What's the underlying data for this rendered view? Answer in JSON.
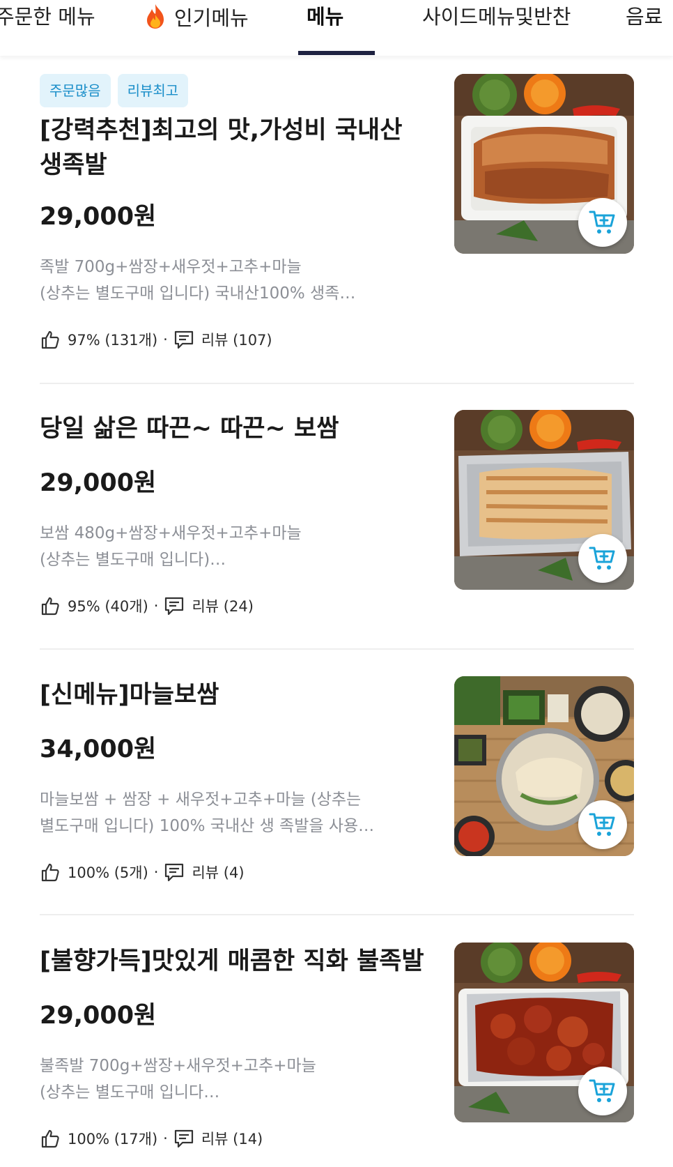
{
  "tabs": [
    {
      "label": "주문한 메뉴",
      "active": false
    },
    {
      "label": "인기메뉴",
      "active": false,
      "icon": "fire-icon"
    },
    {
      "label": "메뉴",
      "active": true
    },
    {
      "label": "사이드메뉴및반찬",
      "active": false
    },
    {
      "label": "음료",
      "active": false
    }
  ],
  "items": [
    {
      "badges": [
        "주문많음",
        "리뷰최고"
      ],
      "name": "[강력추천]최고의 맛,가성비 국내산 생족발",
      "price": "29,000원",
      "desc_line1": "족발 700g+쌈장+새우젓+고추+마늘",
      "desc_line2": " (상추는 별도구매 입니다) 국내산100% 생족…",
      "rating": "97% (131개)",
      "reviews": "리뷰 (107)",
      "image": "jokbal-photo"
    },
    {
      "badges": [],
      "name": "당일 삶은 따끈~ 따끈~ 보쌈",
      "price": "29,000원",
      "desc_line1": "보쌈 480g+쌈장+새우젓+고추+마늘",
      "desc_line2": " (상추는 별도구매 입니다)…",
      "rating": "95% (40개)",
      "reviews": "리뷰 (24)",
      "image": "bossam-photo"
    },
    {
      "badges": [],
      "name": "[신메뉴]마늘보쌈",
      "price": "34,000원",
      "desc_line1": "마늘보쌈 + 쌈장 + 새우젓+고추+마늘 (상추는",
      "desc_line2": "별도구매 입니다) 100% 국내산 생 족발을 사용…",
      "rating": "100% (5개)",
      "reviews": "리뷰 (4)",
      "image": "garlic-bossam-photo"
    },
    {
      "badges": [],
      "name": "[불향가득]맛있게 매콤한 직화 불족발",
      "price": "29,000원",
      "desc_line1": "불족발 700g+쌈장+새우젓+고추+마늘",
      "desc_line2": " (상추는 별도구매 입니다…",
      "rating": "100% (17개)",
      "reviews": "리뷰 (14)",
      "image": "spicy-jokbal-photo"
    }
  ],
  "colors": {
    "badge_bg": "#e2f3fb",
    "badge_text": "#1a8ec9",
    "cart_icon": "#1aa3d9",
    "tab_indicator": "#1d2140",
    "desc_text": "#8c8f96"
  }
}
